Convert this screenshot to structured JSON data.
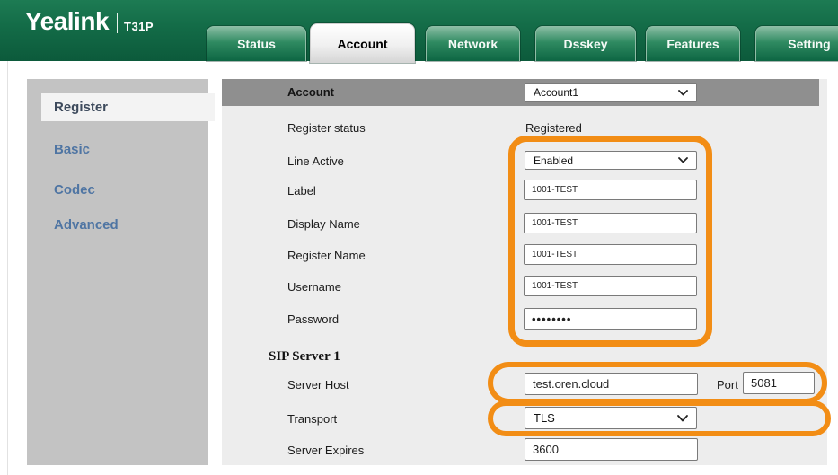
{
  "brand": {
    "logo": "Yealink",
    "model": "T31P"
  },
  "tabs": [
    {
      "label": "Status"
    },
    {
      "label": "Account"
    },
    {
      "label": "Network"
    },
    {
      "label": "Dsskey"
    },
    {
      "label": "Features"
    },
    {
      "label": "Setting"
    }
  ],
  "sidebar": {
    "items": [
      {
        "label": "Register",
        "active": true
      },
      {
        "label": "Basic",
        "active": false
      },
      {
        "label": "Codec",
        "active": false
      },
      {
        "label": "Advanced",
        "active": false
      }
    ]
  },
  "form": {
    "account": {
      "label": "Account",
      "value": "Account1"
    },
    "register_status": {
      "label": "Register status",
      "value": "Registered"
    },
    "line_active": {
      "label": "Line Active",
      "value": "Enabled"
    },
    "label_field": {
      "label": "Label",
      "value": "1001-TEST"
    },
    "display_name": {
      "label": "Display Name",
      "value": "1001-TEST"
    },
    "register_name": {
      "label": "Register Name",
      "value": "1001-TEST"
    },
    "username": {
      "label": "Username",
      "value": "1001-TEST"
    },
    "password": {
      "label": "Password",
      "value": "••••••••"
    },
    "sip_section": {
      "label": "SIP Server 1"
    },
    "server_host": {
      "label": "Server Host",
      "value": "test.oren.cloud",
      "port_label": "Port",
      "port_value": "5081"
    },
    "transport": {
      "label": "Transport",
      "value": "TLS"
    },
    "server_expires": {
      "label": "Server Expires",
      "value": "3600"
    }
  },
  "colors": {
    "header_green": "#0d6243",
    "tab_green": "#0e6843",
    "active_tab": "#ffffff",
    "accent_orange": "#f28d15",
    "sidebar_gray": "#c3c3c3",
    "account_bar_gray": "#8f8f8f",
    "form_bg": "#ededed",
    "sidebar_link_blue": "#4f75a3"
  }
}
